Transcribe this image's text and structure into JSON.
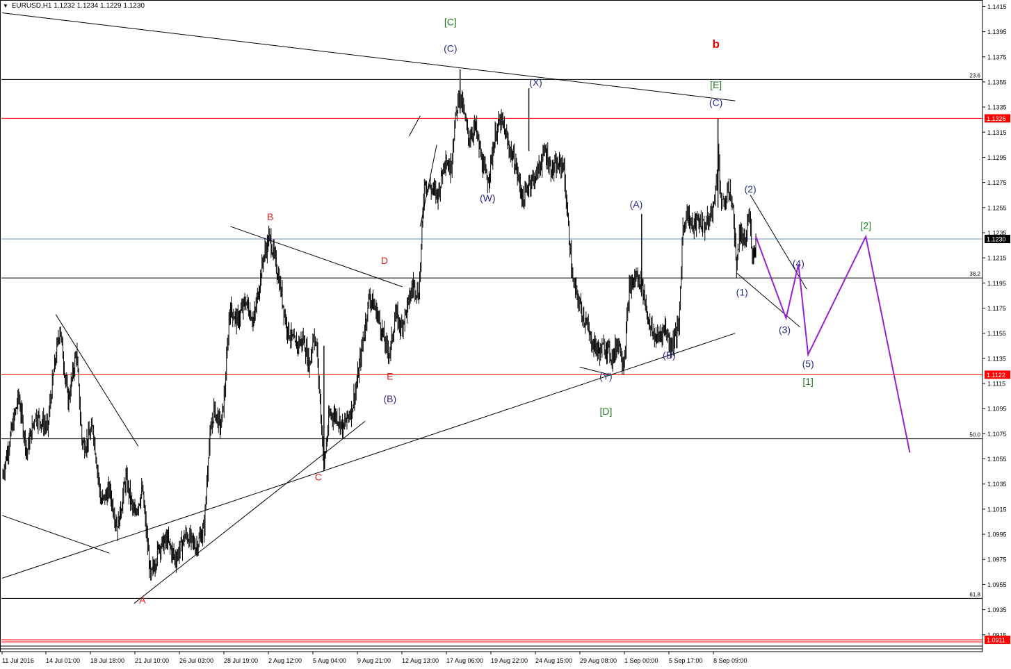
{
  "header": {
    "symbol_timeframe": "EURUSD,H1",
    "ohlc": "1.1232 1.1234 1.1229 1.1230"
  },
  "colors": {
    "grid_line": "#000000",
    "level_red": "#ff0000",
    "current_price": "#6a8fd0",
    "forecast": "#9a1fd0",
    "label_red": "#e02020",
    "label_blue": "#2a2a8a",
    "label_green": "#1f7a1f",
    "label_b": "#dd0000"
  },
  "chart_data": {
    "type": "candlestick",
    "symbol": "EURUSD",
    "timeframe": "H1",
    "ylim": [
      1.0911,
      1.1418
    ],
    "y_ticks": [
      1.1415,
      1.1395,
      1.1375,
      1.1355,
      1.1335,
      1.1315,
      1.1295,
      1.1275,
      1.1255,
      1.1235,
      1.1215,
      1.1195,
      1.1175,
      1.1155,
      1.1135,
      1.1115,
      1.1095,
      1.1075,
      1.1055,
      1.1035,
      1.1015,
      1.0995,
      1.0975,
      1.0955,
      1.0935,
      1.0915
    ],
    "x_ticks": [
      "11 Jul 2016",
      "14 Jul 01:00",
      "18 Jul 18:00",
      "21 Jul 10:00",
      "26 Jul 03:00",
      "28 Jul 19:00",
      "2 Aug 12:00",
      "5 Aug 04:00",
      "9 Aug 21:00",
      "12 Aug 13:00",
      "17 Aug 06:00",
      "19 Aug 22:00",
      "24 Aug 15:00",
      "29 Aug 08:00",
      "1 Sep 00:00",
      "5 Sep 17:00",
      "8 Sep 09:00"
    ],
    "current_price": "1.1230",
    "price_tags": [
      {
        "price": 1.1326,
        "label": "1.1326",
        "color": "red"
      },
      {
        "price": 1.123,
        "label": "1.1230",
        "color": "black"
      },
      {
        "price": 1.1122,
        "label": "1.1122",
        "color": "red"
      },
      {
        "price": 1.0911,
        "label": "1.0911",
        "color": "red"
      }
    ],
    "fibonacci": [
      {
        "price": 1.1357,
        "label": "23.6"
      },
      {
        "price": 1.1199,
        "label": "38.2"
      },
      {
        "price": 1.1071,
        "label": "50.0"
      },
      {
        "price": 1.0944,
        "label": "61.8"
      }
    ],
    "horizontal_red": [
      1.1326,
      1.1122,
      1.0911
    ],
    "price_path": [
      {
        "date": "11 Jul 2016 00:00",
        "price": 1.104
      },
      {
        "date": "12 Jul 2016 00:00",
        "price": 1.1105
      },
      {
        "date": "12 Jul 2016 12:00",
        "price": 1.106
      },
      {
        "date": "13 Jul 2016 00:00",
        "price": 1.109
      },
      {
        "date": "13 Jul 2016 18:00",
        "price": 1.108
      },
      {
        "date": "14 Jul 2016 01:00",
        "price": 1.1115
      },
      {
        "date": "14 Jul 2016 12:00",
        "price": 1.116
      },
      {
        "date": "15 Jul 2016 00:00",
        "price": 1.11
      },
      {
        "date": "15 Jul 2016 12:00",
        "price": 1.114
      },
      {
        "date": "15 Jul 2016 20:00",
        "price": 1.107
      },
      {
        "date": "18 Jul 2016 00:00",
        "price": 1.1065
      },
      {
        "date": "18 Jul 2016 12:00",
        "price": 1.108
      },
      {
        "date": "19 Jul 2016 00:00",
        "price": 1.102
      },
      {
        "date": "19 Jul 2016 12:00",
        "price": 1.103
      },
      {
        "date": "20 Jul 2016 00:00",
        "price": 1.1
      },
      {
        "date": "20 Jul 2016 12:00",
        "price": 1.104
      },
      {
        "date": "21 Jul 2016 00:00",
        "price": 1.101
      },
      {
        "date": "21 Jul 2016 12:00",
        "price": 1.103
      },
      {
        "date": "22 Jul 2016 00:00",
        "price": 1.096
      },
      {
        "date": "22 Jul 2016 12:00",
        "price": 1.0985
      },
      {
        "date": "25 Jul 2016 00:00",
        "price": 1.099
      },
      {
        "date": "25 Jul 2016 12:00",
        "price": 1.0975
      },
      {
        "date": "26 Jul 2016 03:00",
        "price": 1.0995
      },
      {
        "date": "26 Jul 2016 18:00",
        "price": 1.0985
      },
      {
        "date": "27 Jul 2016 06:00",
        "price": 1.1
      },
      {
        "date": "27 Jul 2016 12:00",
        "price": 1.106
      },
      {
        "date": "27 Jul 2016 20:00",
        "price": 1.1095
      },
      {
        "date": "28 Jul 2016 06:00",
        "price": 1.108
      },
      {
        "date": "28 Jul 2016 12:00",
        "price": 1.111
      },
      {
        "date": "28 Jul 2016 19:00",
        "price": 1.1175
      },
      {
        "date": "29 Jul 2016 06:00",
        "price": 1.1165
      },
      {
        "date": "29 Jul 2016 18:00",
        "price": 1.118
      },
      {
        "date": "1 Aug 2016 06:00",
        "price": 1.1165
      },
      {
        "date": "1 Aug 2016 20:00",
        "price": 1.1215
      },
      {
        "date": "2 Aug 2016 05:00",
        "price": 1.1232
      },
      {
        "date": "2 Aug 2016 18:00",
        "price": 1.12
      },
      {
        "date": "3 Aug 2016 06:00",
        "price": 1.116
      },
      {
        "date": "3 Aug 2016 18:00",
        "price": 1.1145
      },
      {
        "date": "4 Aug 2016 06:00",
        "price": 1.115
      },
      {
        "date": "4 Aug 2016 15:00",
        "price": 1.113
      },
      {
        "date": "4 Aug 2016 21:00",
        "price": 1.1155
      },
      {
        "date": "5 Aug 2016 02:00",
        "price": 1.114
      },
      {
        "date": "5 Aug 2016 12:00",
        "price": 1.105
      },
      {
        "date": "5 Aug 2016 20:00",
        "price": 1.109
      },
      {
        "date": "8 Aug 2016 06:00",
        "price": 1.109
      },
      {
        "date": "8 Aug 2016 16:00",
        "price": 1.108
      },
      {
        "date": "9 Aug 2016 04:00",
        "price": 1.1095
      },
      {
        "date": "9 Aug 2016 12:00",
        "price": 1.1115
      },
      {
        "date": "9 Aug 2016 21:00",
        "price": 1.115
      },
      {
        "date": "10 Aug 2016 06:00",
        "price": 1.1185
      },
      {
        "date": "10 Aug 2016 18:00",
        "price": 1.117
      },
      {
        "date": "11 Aug 2016 06:00",
        "price": 1.1145
      },
      {
        "date": "11 Aug 2016 12:00",
        "price": 1.114
      },
      {
        "date": "11 Aug 2016 20:00",
        "price": 1.117
      },
      {
        "date": "12 Aug 2016 04:00",
        "price": 1.116
      },
      {
        "date": "12 Aug 2016 13:00",
        "price": 1.1175
      },
      {
        "date": "12 Aug 2016 22:00",
        "price": 1.1195
      },
      {
        "date": "15 Aug 2016 06:00",
        "price": 1.1185
      },
      {
        "date": "15 Aug 2016 14:00",
        "price": 1.1275
      },
      {
        "date": "16 Aug 2016 00:00",
        "price": 1.127
      },
      {
        "date": "16 Aug 2016 10:00",
        "price": 1.1265
      },
      {
        "date": "16 Aug 2016 20:00",
        "price": 1.1295
      },
      {
        "date": "17 Aug 2016 04:00",
        "price": 1.1285
      },
      {
        "date": "17 Aug 2016 10:00",
        "price": 1.132
      },
      {
        "date": "17 Aug 2016 16:00",
        "price": 1.1345
      },
      {
        "date": "17 Aug 2016 22:00",
        "price": 1.1335
      },
      {
        "date": "18 Aug 2016 06:00",
        "price": 1.131
      },
      {
        "date": "18 Aug 2016 16:00",
        "price": 1.132
      },
      {
        "date": "19 Aug 2016 02:00",
        "price": 1.129
      },
      {
        "date": "19 Aug 2016 10:00",
        "price": 1.1275
      },
      {
        "date": "19 Aug 2016 22:00",
        "price": 1.1315
      },
      {
        "date": "22 Aug 2016 06:00",
        "price": 1.1325
      },
      {
        "date": "22 Aug 2016 16:00",
        "price": 1.1305
      },
      {
        "date": "23 Aug 2016 02:00",
        "price": 1.129
      },
      {
        "date": "23 Aug 2016 14:00",
        "price": 1.126
      },
      {
        "date": "23 Aug 2016 22:00",
        "price": 1.1275
      },
      {
        "date": "24 Aug 2016 08:00",
        "price": 1.128
      },
      {
        "date": "24 Aug 2016 15:00",
        "price": 1.129
      },
      {
        "date": "24 Aug 2016 22:00",
        "price": 1.13
      },
      {
        "date": "25 Aug 2016 06:00",
        "price": 1.1285
      },
      {
        "date": "26 Aug 2016 00:00",
        "price": 1.129
      },
      {
        "date": "26 Aug 2016 14:00",
        "price": 1.1195
      },
      {
        "date": "26 Aug 2016 20:00",
        "price": 1.1185
      },
      {
        "date": "29 Aug 2016 04:00",
        "price": 1.117
      },
      {
        "date": "29 Aug 2016 08:00",
        "price": 1.1165
      },
      {
        "date": "29 Aug 2016 16:00",
        "price": 1.115
      },
      {
        "date": "30 Aug 2016 04:00",
        "price": 1.114
      },
      {
        "date": "30 Aug 2016 14:00",
        "price": 1.1145
      },
      {
        "date": "31 Aug 2016 00:00",
        "price": 1.1135
      },
      {
        "date": "31 Aug 2016 08:00",
        "price": 1.115
      },
      {
        "date": "31 Aug 2016 16:00",
        "price": 1.113
      },
      {
        "date": "1 Sep 2016 00:00",
        "price": 1.119
      },
      {
        "date": "1 Sep 2016 10:00",
        "price": 1.12
      },
      {
        "date": "1 Sep 2016 18:00",
        "price": 1.1195
      },
      {
        "date": "2 Sep 2016 06:00",
        "price": 1.116
      },
      {
        "date": "2 Sep 2016 16:00",
        "price": 1.115
      },
      {
        "date": "5 Sep 2016 04:00",
        "price": 1.116
      },
      {
        "date": "5 Sep 2016 12:00",
        "price": 1.1145
      },
      {
        "date": "5 Sep 2016 17:00",
        "price": 1.115
      },
      {
        "date": "6 Sep 2016 00:00",
        "price": 1.116
      },
      {
        "date": "6 Sep 2016 06:00",
        "price": 1.124
      },
      {
        "date": "6 Sep 2016 12:00",
        "price": 1.125
      },
      {
        "date": "6 Sep 2016 20:00",
        "price": 1.124
      },
      {
        "date": "7 Sep 2016 04:00",
        "price": 1.1245
      },
      {
        "date": "7 Sep 2016 14:00",
        "price": 1.124
      },
      {
        "date": "7 Sep 2016 20:00",
        "price": 1.1245
      },
      {
        "date": "8 Sep 2016 04:00",
        "price": 1.126
      },
      {
        "date": "8 Sep 2016 09:00",
        "price": 1.13
      },
      {
        "date": "8 Sep 2016 14:00",
        "price": 1.1255
      },
      {
        "date": "8 Sep 2016 20:00",
        "price": 1.126
      },
      {
        "date": "9 Sep 2016 02:00",
        "price": 1.127
      },
      {
        "date": "9 Sep 2016 08:00",
        "price": 1.1245
      },
      {
        "date": "9 Sep 2016 12:00",
        "price": 1.1205
      },
      {
        "date": "9 Sep 2016 16:00",
        "price": 1.1235
      },
      {
        "date": "12 Sep 2016 00:00",
        "price": 1.1225
      },
      {
        "date": "12 Sep 2016 06:00",
        "price": 1.125
      },
      {
        "date": "12 Sep 2016 12:00",
        "price": 1.1215
      },
      {
        "date": "12 Sep 2016 16:00",
        "price": 1.123
      }
    ],
    "wicks": [
      {
        "date": "17 Aug 2016 18:00",
        "high": 1.1365,
        "low": 1.133
      },
      {
        "date": "23 Aug 2016 22:00",
        "high": 1.135,
        "low": 1.13
      },
      {
        "date": "8 Sep 2016 09:00",
        "high": 1.1326,
        "low": 1.1255
      },
      {
        "date": "1 Sep 2016 18:00",
        "high": 1.125,
        "low": 1.1185
      },
      {
        "date": "5 Aug 2016 12:00",
        "high": 1.1145,
        "low": 1.1045
      }
    ],
    "forecast_path": [
      {
        "date": "12 Sep 2016 16:00",
        "price": 1.1232
      },
      {
        "date": "14 Sep 2016 12:00",
        "price": 1.1167
      },
      {
        "date": "15 Sep 2016 06:00",
        "price": 1.121
      },
      {
        "date": "15 Sep 2016 20:00",
        "price": 1.1138
      },
      {
        "date": "21 Sep 2016 08:00",
        "price": 1.1232
      },
      {
        "date": "25 Sep 2016 00:00",
        "price": 1.106
      }
    ],
    "wave_labels": [
      {
        "text": "[C]",
        "color": "green",
        "date": "17 Aug 2016 04:00",
        "price": 1.14
      },
      {
        "text": "(C)",
        "color": "blue",
        "date": "17 Aug 2016 04:00",
        "price": 1.1379
      },
      {
        "text": "(X)",
        "color": "blue",
        "date": "24 Aug 2016 08:00",
        "price": 1.1352
      },
      {
        "text": "(W)",
        "color": "blue",
        "date": "19 Aug 2016 10:00",
        "price": 1.126
      },
      {
        "text": "b",
        "color": "label_b",
        "date": "8 Sep 2016 06:00",
        "price": 1.1382
      },
      {
        "text": "[E]",
        "color": "green",
        "date": "8 Sep 2016 06:00",
        "price": 1.135
      },
      {
        "text": "(C)",
        "color": "blue",
        "date": "8 Sep 2016 06:00",
        "price": 1.1336
      },
      {
        "text": "(A)",
        "color": "blue",
        "date": "1 Sep 2016 10:00",
        "price": 1.1255
      },
      {
        "text": "(B)",
        "color": "blue",
        "date": "5 Sep 2016 10:00",
        "price": 1.1135
      },
      {
        "text": "(Y)",
        "color": "blue",
        "date": "30 Aug 2016 14:00",
        "price": 1.1118
      },
      {
        "text": "[D]",
        "color": "green",
        "date": "30 Aug 2016 14:00",
        "price": 1.109
      },
      {
        "text": "(1)",
        "color": "blue",
        "date": "9 Sep 2016 20:00",
        "price": 1.1185
      },
      {
        "text": "(2)",
        "color": "blue",
        "date": "12 Sep 2016 08:00",
        "price": 1.1267
      },
      {
        "text": "(3)",
        "color": "blue",
        "date": "14 Sep 2016 10:00",
        "price": 1.1155
      },
      {
        "text": "(4)",
        "color": "blue",
        "date": "15 Sep 2016 06:00",
        "price": 1.1208
      },
      {
        "text": "(5)",
        "color": "blue",
        "date": "15 Sep 2016 20:00",
        "price": 1.1128
      },
      {
        "text": "[1]",
        "color": "green",
        "date": "15 Sep 2016 20:00",
        "price": 1.1114
      },
      {
        "text": "[2]",
        "color": "green",
        "date": "21 Sep 2016 08:00",
        "price": 1.1238
      },
      {
        "text": "A",
        "color": "red",
        "date": "21 Jul 2016 12:00",
        "price": 1.094
      },
      {
        "text": "B",
        "color": "red",
        "date": "2 Aug 2016 06:00",
        "price": 1.1245
      },
      {
        "text": "C",
        "color": "red",
        "date": "5 Aug 2016 04:00",
        "price": 1.1038
      },
      {
        "text": "D",
        "color": "red",
        "date": "11 Aug 2016 04:00",
        "price": 1.121
      },
      {
        "text": "E",
        "color": "red",
        "date": "11 Aug 2016 12:00",
        "price": 1.1118
      },
      {
        "text": "(B)",
        "color": "blue",
        "date": "11 Aug 2016 12:00",
        "price": 1.11
      }
    ],
    "trendlines": [
      {
        "from": {
          "date": "11 Jul 2016 00:00",
          "price": 1.141
        },
        "to": {
          "date": "9 Sep 2016 10:00",
          "price": 1.134
        }
      },
      {
        "from": {
          "date": "11 Jul 2016 00:00",
          "price": 1.096
        },
        "to": {
          "date": "9 Sep 2016 10:00",
          "price": 1.1155
        }
      },
      {
        "from": {
          "date": "11 Jul 2016 00:00",
          "price": 1.101
        },
        "to": {
          "date": "19 Jul 2016 12:00",
          "price": 1.098
        }
      },
      {
        "from": {
          "date": "14 Jul 2016 06:00",
          "price": 1.117
        },
        "to": {
          "date": "21 Jul 2016 06:00",
          "price": 1.1065
        }
      },
      {
        "from": {
          "date": "21 Jul 2016 00:00",
          "price": 1.094
        },
        "to": {
          "date": "10 Aug 2016 00:00",
          "price": 1.1085
        }
      },
      {
        "from": {
          "date": "28 Jul 2016 20:00",
          "price": 1.124
        },
        "to": {
          "date": "12 Aug 2016 06:00",
          "price": 1.1192
        }
      },
      {
        "from": {
          "date": "12 Aug 2016 16:00",
          "price": 1.1312
        },
        "to": {
          "date": "15 Aug 2016 08:00",
          "price": 1.1328
        }
      },
      {
        "from": {
          "date": "15 Aug 2016 08:00",
          "price": 1.124
        },
        "to": {
          "date": "16 Aug 2016 08:00",
          "price": 1.1305
        }
      },
      {
        "from": {
          "date": "29 Aug 2016 00:00",
          "price": 1.1128
        },
        "to": {
          "date": "30 Aug 2016 20:00",
          "price": 1.1122
        }
      },
      {
        "from": {
          "date": "12 Sep 2016 08:00",
          "price": 1.1265
        },
        "to": {
          "date": "15 Sep 2016 18:00",
          "price": 1.119
        }
      },
      {
        "from": {
          "date": "9 Sep 2016 12:00",
          "price": 1.1203
        },
        "to": {
          "date": "15 Sep 2016 08:00",
          "price": 1.116
        }
      }
    ]
  }
}
